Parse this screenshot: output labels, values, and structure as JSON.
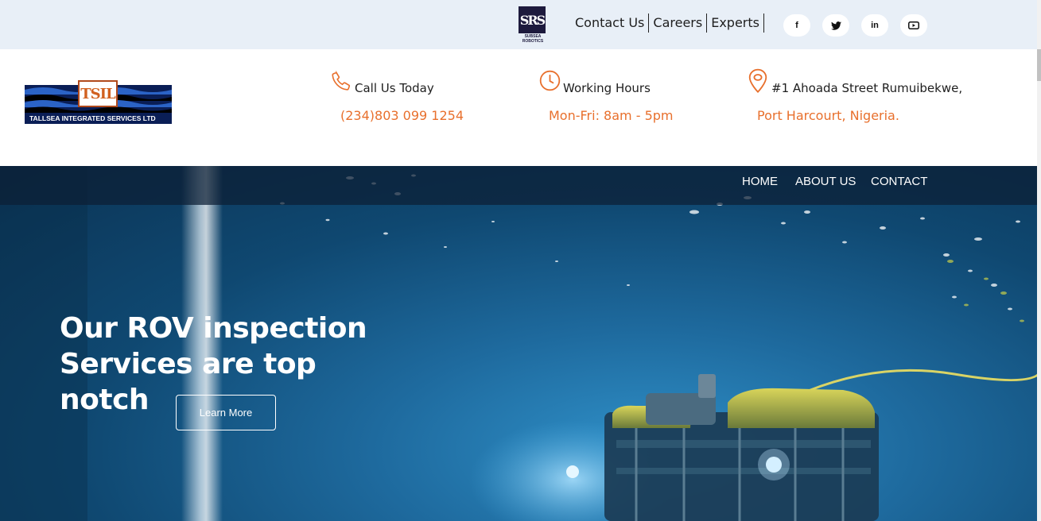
{
  "topbar": {
    "partner_logo": {
      "monogram": "SRS",
      "subtitle_line1": "SUBSEA",
      "subtitle_line2": "ROBOTICS"
    },
    "links": [
      {
        "label": "Contact Us"
      },
      {
        "label": "Careers"
      },
      {
        "label": "Experts"
      }
    ],
    "socials": [
      {
        "icon": "facebook-icon",
        "glyph": "f"
      },
      {
        "icon": "twitter-icon",
        "glyph": ""
      },
      {
        "icon": "linkedin-icon",
        "glyph": "in"
      },
      {
        "icon": "youtube-icon",
        "glyph": ""
      }
    ]
  },
  "header": {
    "brand": {
      "monogram": "TSIL",
      "name": "TALLSEA INTEGRATED SERVICES LTD"
    },
    "call": {
      "icon": "phone-icon",
      "title": "Call Us Today",
      "value": "(234)803 099 1254"
    },
    "hours": {
      "icon": "clock-icon",
      "title": "Working Hours",
      "value": "Mon-Fri: 8am - 5pm"
    },
    "address": {
      "icon": "location-pin-icon",
      "title": "#1 Ahoada Street Rumuibekwe,",
      "value": "Port Harcourt, Nigeria."
    }
  },
  "nav": {
    "items": [
      {
        "label": "HOME"
      },
      {
        "label": "ABOUT US"
      },
      {
        "label": "CONTACT"
      }
    ]
  },
  "hero": {
    "title_line1": "Our ROV inspection",
    "title_line2": "Services are top notch",
    "button_label": "Learn More"
  },
  "colors": {
    "accent": "#e8702d",
    "topbar_bg": "#e8eff7",
    "brand_navy": "#0a1e56",
    "hero_blue": "#1e6a9e"
  }
}
